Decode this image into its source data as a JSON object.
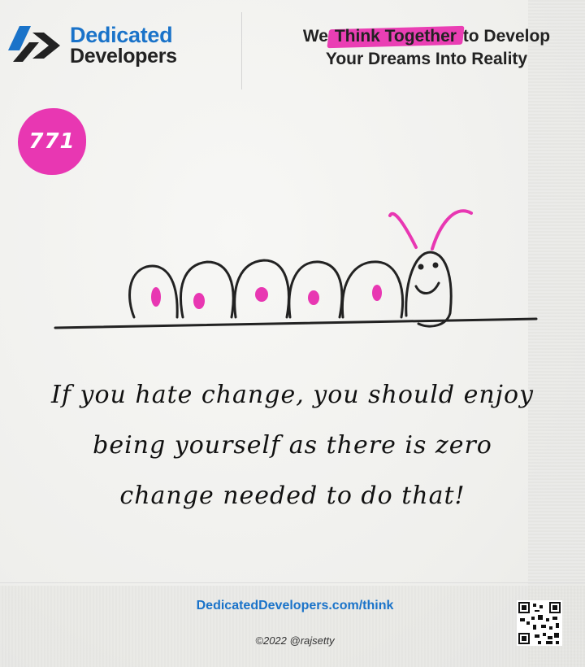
{
  "header": {
    "brand_line1": "Dedicated",
    "brand_line2": "Developers",
    "tagline_before": "We ",
    "tagline_highlight": "Think Together",
    "tagline_after": " to Develop",
    "tagline_line2": "Your Dreams Into Reality"
  },
  "badge": {
    "number": "771"
  },
  "quote": {
    "line1": "If you hate change, you should enjoy",
    "line2": "being yourself as there is zero",
    "line3": "change needed to do that!"
  },
  "footer": {
    "site": "DedicatedDevelopers.com/think",
    "copyright": "©2022 @rajsetty"
  },
  "colors": {
    "brand_blue": "#1a73c9",
    "accent_pink": "#e837b2",
    "ink": "#222222"
  },
  "icons": {
    "logo": "dedicated-developers-logo-icon",
    "qr": "qr-code-icon"
  }
}
